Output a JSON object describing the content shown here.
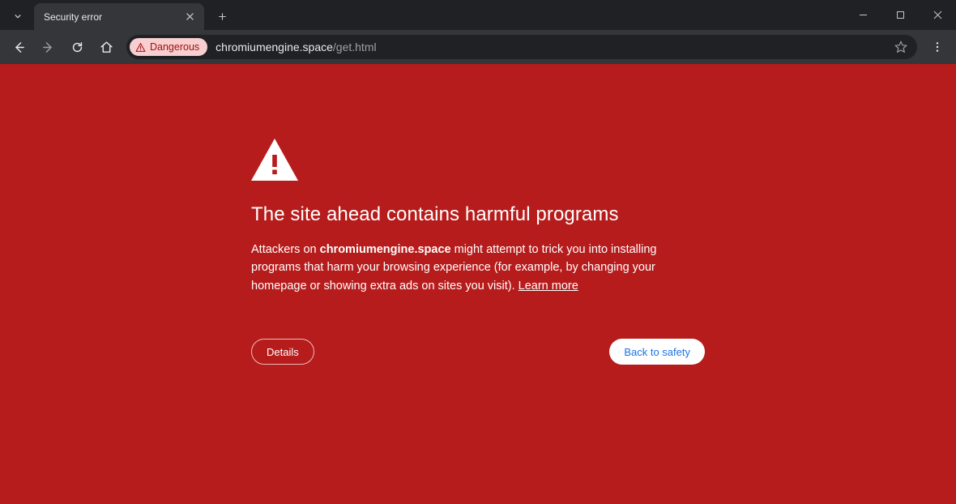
{
  "tab": {
    "title": "Security error"
  },
  "address": {
    "danger_label": "Dangerous",
    "host": "chromiumengine.space",
    "path": "/get.html"
  },
  "warning": {
    "headline": "The site ahead contains harmful programs",
    "pre": "Attackers on ",
    "domain": "chromiumengine.space",
    "post": " might attempt to trick you into installing programs that harm your browsing experience (for example, by changing your homepage or showing extra ads on sites you visit). ",
    "learn_more": "Learn more"
  },
  "buttons": {
    "details": "Details",
    "back_to_safety": "Back to safety"
  }
}
